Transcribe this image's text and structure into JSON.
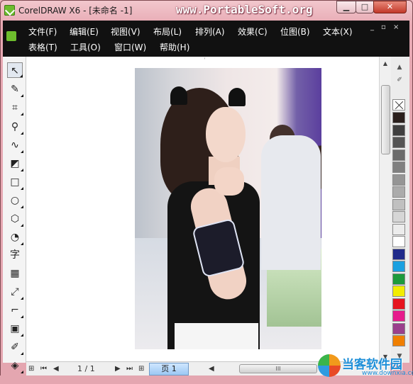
{
  "window": {
    "title": "CorelDRAW X6 - [未命名 -1]",
    "watermark": "www.PortableSoft.org",
    "controls": {
      "minimize": "▁",
      "maximize": "□",
      "close": "✕"
    }
  },
  "menu": {
    "row1": [
      "文件(F)",
      "编辑(E)",
      "视图(V)",
      "布局(L)",
      "排列(A)",
      "效果(C)",
      "位图(B)",
      "文本(X)"
    ],
    "row2": [
      "表格(T)",
      "工具(O)",
      "窗口(W)",
      "帮助(H)"
    ],
    "mdi_controls": [
      "_",
      "▫",
      "×"
    ]
  },
  "toolbox": [
    "pick-tool",
    "shape-tool",
    "crop-tool",
    "zoom-tool",
    "freehand-tool",
    "smart-fill-tool",
    "rectangle-tool",
    "ellipse-tool",
    "polygon-tool",
    "basic-shapes-tool",
    "text-tool",
    "table-tool",
    "dimension-tool",
    "connector-tool",
    "interactive-effects-tool",
    "eyedropper-tool",
    "outline-tool"
  ],
  "toolbox_text_glyph": "字",
  "palette": {
    "colors": [
      "#2a1f1c",
      "#3f3f3f",
      "#555555",
      "#6b6b6b",
      "#808080",
      "#959595",
      "#ababab",
      "#c0c0c0",
      "#d6d6d6",
      "#ececec",
      "#ffffff",
      "#1f2a8a",
      "#1aa0e0",
      "#1d9a3c",
      "#f2ec00",
      "#e6141e",
      "#e61b8c",
      "#9a3f8c",
      "#f07f00"
    ]
  },
  "navigation": {
    "page_counter": "1 / 1",
    "page_tab": "页 1",
    "hscroll_grip": "III"
  },
  "logo": {
    "text": "当客软件园",
    "subtext": "www.downxia.com"
  }
}
